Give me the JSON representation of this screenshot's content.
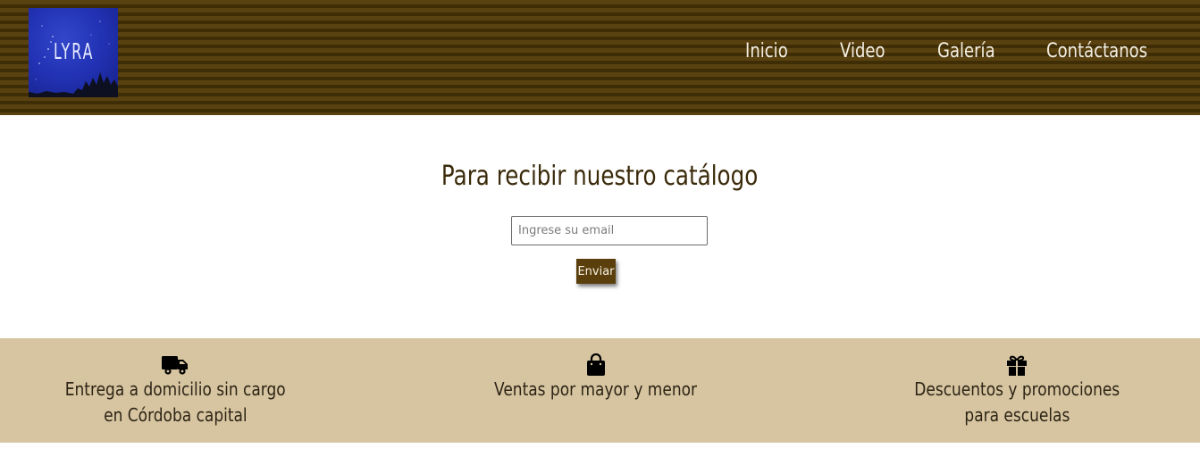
{
  "logo": {
    "text": "LYRA"
  },
  "nav": {
    "items": [
      {
        "label": "Inicio"
      },
      {
        "label": "Video"
      },
      {
        "label": "Galería"
      },
      {
        "label": "Contáctanos"
      }
    ]
  },
  "catalog": {
    "title": "Para recibir nuestro catálogo",
    "email_placeholder": "Ingrese su email",
    "email_value": "",
    "submit_label": "Enviar"
  },
  "benefits": [
    {
      "icon": "truck-icon",
      "line1": "Entrega a domicilio sin cargo",
      "line2": "en Córdoba capital"
    },
    {
      "icon": "shopping-bag-icon",
      "line1": "Ventas por mayor y menor",
      "line2": ""
    },
    {
      "icon": "gift-icon",
      "line1": "Descuentos y promociones",
      "line2": "para escuelas"
    }
  ],
  "colors": {
    "header_stripe_light": "#5a4210",
    "header_stripe_dark": "#3f2d06",
    "button_bg": "#5a3f0c",
    "benefits_bg": "#d6c5a0",
    "logo_bg": "#2233b6"
  }
}
